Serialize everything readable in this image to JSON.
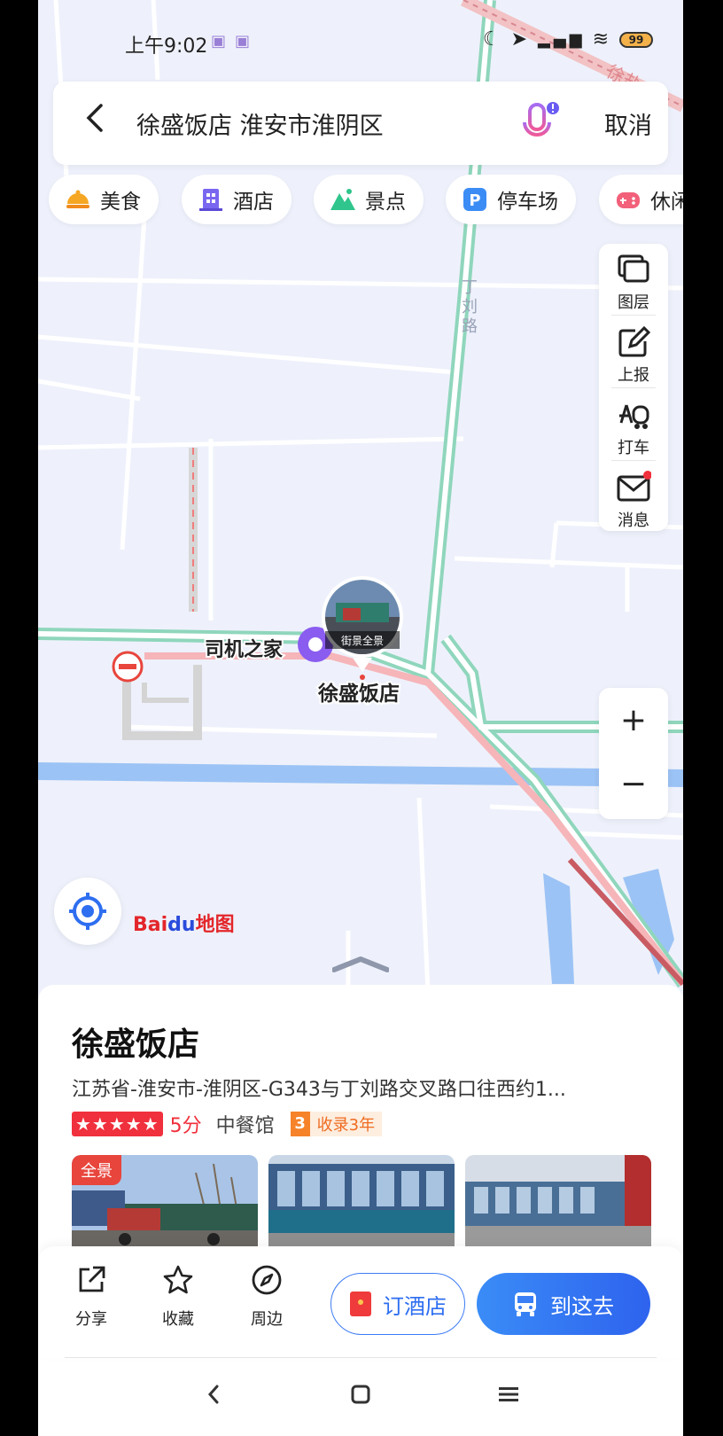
{
  "status_bar": {
    "time": "上午9:02",
    "battery": "99"
  },
  "search": {
    "query": "徐盛饭店 淮安市淮阴区",
    "cancel_label": "取消"
  },
  "categories": [
    {
      "label": "美食",
      "icon": "food-icon",
      "color": "#f5a623"
    },
    {
      "label": "酒店",
      "icon": "hotel-icon",
      "color": "#7a67f0"
    },
    {
      "label": "景点",
      "icon": "scenic-icon",
      "color": "#2fc58c"
    },
    {
      "label": "停车场",
      "icon": "parking-icon",
      "color": "#3b8cf5"
    },
    {
      "label": "休闲",
      "icon": "leisure-icon",
      "color": "#f2607a"
    }
  ],
  "map_tools": [
    {
      "label": "图层",
      "icon": "layers-icon"
    },
    {
      "label": "上报",
      "icon": "report-icon"
    },
    {
      "label": "打车",
      "icon": "taxi-icon"
    },
    {
      "label": "消息",
      "icon": "message-icon"
    }
  ],
  "map": {
    "road_label": "丁刘路",
    "road_label_top": "徐盐",
    "poi_driver_home": "司机之家",
    "poi_restaurant": "徐盛饭店",
    "streetview_label": "街景全景",
    "zoom_in": "+",
    "zoom_out": "−",
    "logo_bai": "Bai",
    "logo_du": "du",
    "logo_map": "地图"
  },
  "place": {
    "name": "徐盛饭店",
    "address": "江苏省-淮安市-淮阴区-G343与丁刘路交叉路口往西约1...",
    "stars": "★★★★★",
    "score": "5分",
    "category": "中餐馆",
    "badge_num": "3",
    "badge_text": "收录3年",
    "panorama_tag": "全景"
  },
  "actions": {
    "share": "分享",
    "favorite": "收藏",
    "nearby": "周边",
    "book_hotel": "订酒店",
    "go_here": "到这去"
  },
  "colors": {
    "accent_blue": "#2e6ef0",
    "red": "#f0303c",
    "map_bg": "#eef1fb"
  }
}
